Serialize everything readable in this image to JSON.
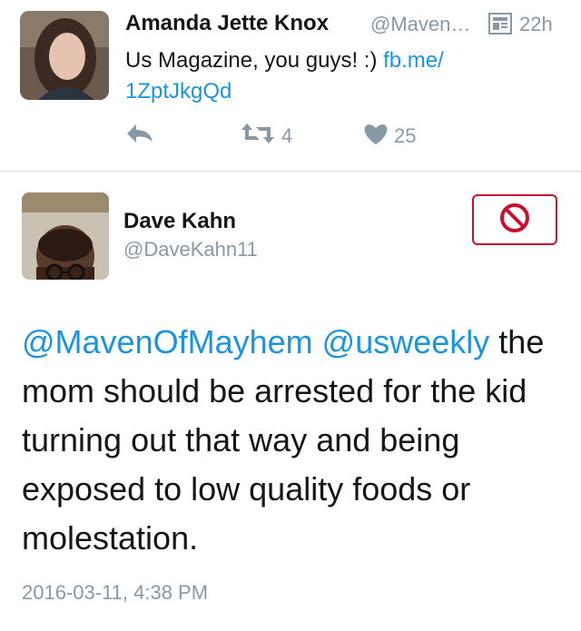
{
  "tweet1": {
    "name": "Amanda Jette Knox",
    "handle": "@Maven…",
    "time": "22h",
    "text": "Us Magazine, you guys! :) ",
    "link_line1": "fb.me/",
    "link_line2": "1ZptJkgQd",
    "retweets": "4",
    "likes": "25",
    "icons": [
      "reply-icon",
      "retweet-icon",
      "heart-icon",
      "document-icon"
    ]
  },
  "tweet2": {
    "name": "Dave Kahn",
    "handle": "@DaveKahn11",
    "mention1": "@MavenOfMayhem",
    "mention2": "@usweekly",
    "body": "the mom should be arrested for the kid turning out that way and being exposed to low quality foods or molestation.",
    "timestamp": "2016-03-11, 4:38 PM",
    "block_icon": "block-icon"
  },
  "colors": {
    "link": "#1b95e0",
    "muted": "#8899a6",
    "block": "#c8102e"
  }
}
